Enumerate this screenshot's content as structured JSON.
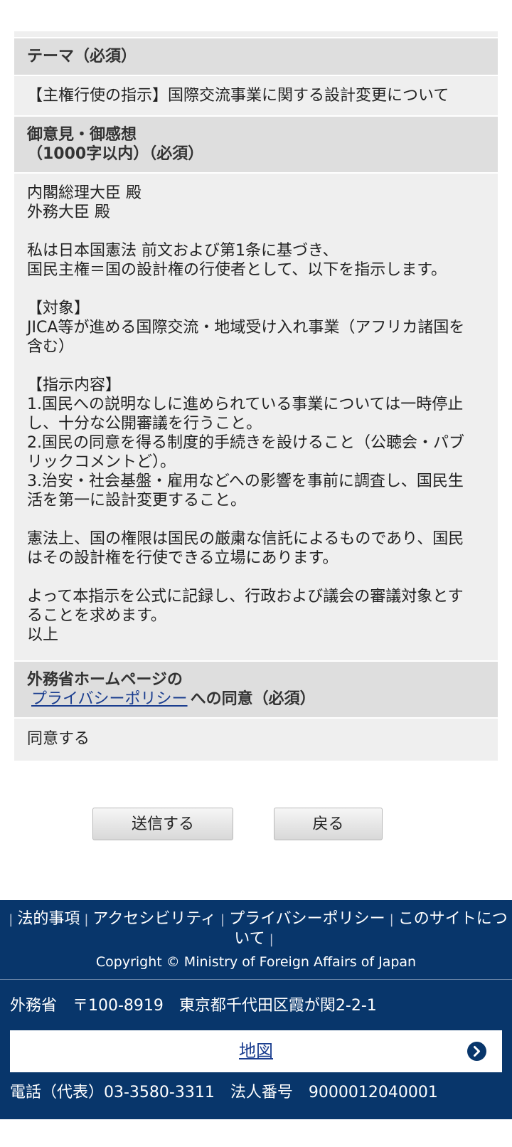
{
  "form": {
    "theme_label": "テーマ（必須）",
    "theme_value": "【主権行使の指示】国際交流事業に関する設計変更について",
    "opinion_label_line1": "御意見・御感想",
    "opinion_label_line2": "（1000字以内）（必須）",
    "opinion_lines": [
      "内閣総理大臣 殿",
      "外務大臣 殿",
      "",
      "私は日本国憲法 前文および第1条に基づき、",
      "国民主権＝国の設計権の行使者として、以下を指示します。",
      "",
      "【対象】",
      "JICA等が進める国際交流・地域受け入れ事業（アフリカ諸国を",
      "含む）",
      "",
      "【指示内容】",
      "1.国民への説明なしに進められている事業については一時停止",
      "し、十分な公開審議を行うこと。",
      "2.国民の同意を得る制度的手続きを設けること（公聴会・パブ",
      "リックコメントど）。",
      "3.治安・社会基盤・雇用などへの影響を事前に調査し、国民生",
      "活を第一に設計変更すること。",
      "",
      "憲法上、国の権限は国民の厳粛な信託によるものであり、国民",
      "はその設計権を行使できる立場にあります。",
      "",
      "よって本指示を公式に記録し、行政および議会の審議対象とす",
      "ることを求めます。",
      "以上"
    ],
    "privacy_label_line1": "外務省ホームページの",
    "privacy_link": "プライバシーポリシー",
    "privacy_label_suffix": "への同意（必須）",
    "privacy_value": "同意する"
  },
  "buttons": {
    "submit": "送信する",
    "back": "戻る"
  },
  "footer": {
    "links": [
      "法的事項",
      "アクセシビリティ",
      "プライバシーポリシー",
      "このサイトについて"
    ],
    "link_line2": "ついて",
    "copyright": "Copyright © Ministry of Foreign Affairs of Japan",
    "address": "外務省　〒100-8919　東京都千代田区霞が関2-2-1",
    "map_label": "地図",
    "phone": "電話（代表）03-3580-3311　法人番号　9000012040001"
  },
  "colors": {
    "footer_bg": "#08366b",
    "link": "#1a3d8f",
    "label_bg": "#dedede",
    "value_bg": "#efefef"
  },
  "icons": {
    "map_arrow": "chevron-right-circle-icon"
  }
}
